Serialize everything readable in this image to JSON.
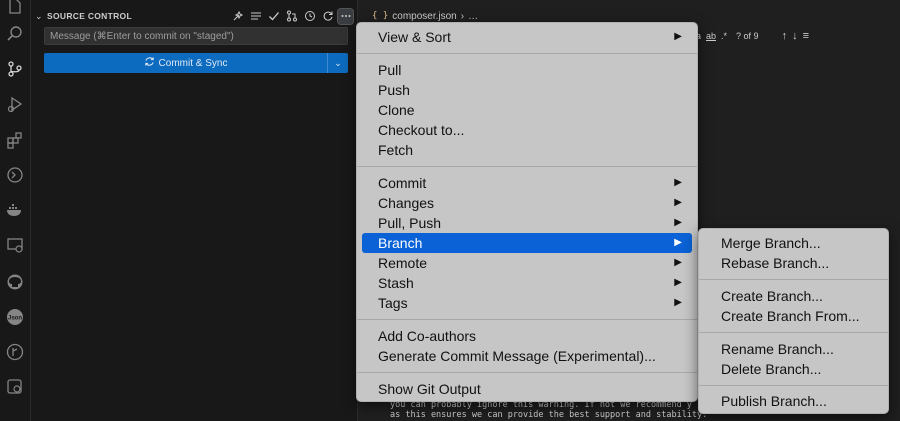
{
  "source_control": {
    "title": "SOURCE CONTROL",
    "message_placeholder": "Message (⌘Enter to commit on \"staged\")",
    "commit_button": "Commit & Sync"
  },
  "editor": {
    "tab_label": "composer.json",
    "tab_ellipsis": "…",
    "find": {
      "match_case": "Aa",
      "whole_word": "ab",
      "regex": ".*",
      "result": "? of 9"
    },
    "warning_line_1": "you can probably ignore this warning. If not we recommend y",
    "warning_line_2": "as this ensures we can provide the best support and stability."
  },
  "menu": {
    "view_sort": "View & Sort",
    "pull": "Pull",
    "push": "Push",
    "clone": "Clone",
    "checkout": "Checkout to...",
    "fetch": "Fetch",
    "commit": "Commit",
    "changes": "Changes",
    "pull_push": "Pull, Push",
    "branch": "Branch",
    "remote": "Remote",
    "stash": "Stash",
    "tags": "Tags",
    "add_coauthors": "Add Co-authors",
    "generate_commit_message": "Generate Commit Message (Experimental)...",
    "show_git_output": "Show Git Output"
  },
  "submenu": {
    "merge": "Merge Branch...",
    "rebase": "Rebase Branch...",
    "create": "Create Branch...",
    "create_from": "Create Branch From...",
    "rename": "Rename Branch...",
    "delete": "Delete Branch...",
    "publish": "Publish Branch..."
  },
  "activity_icons": [
    "explorer-icon",
    "search-icon",
    "source-control-icon",
    "run-debug-icon",
    "extensions-icon",
    "remote-explorer-icon",
    "docker-icon",
    "remote-window-icon",
    "github-icon",
    "json-icon",
    "git-graph-icon",
    "settings-sync-icon"
  ],
  "colors": {
    "accent": "#0d6bbf",
    "menu_bg": "#c6c6c6",
    "selection": "#0a62d6"
  }
}
